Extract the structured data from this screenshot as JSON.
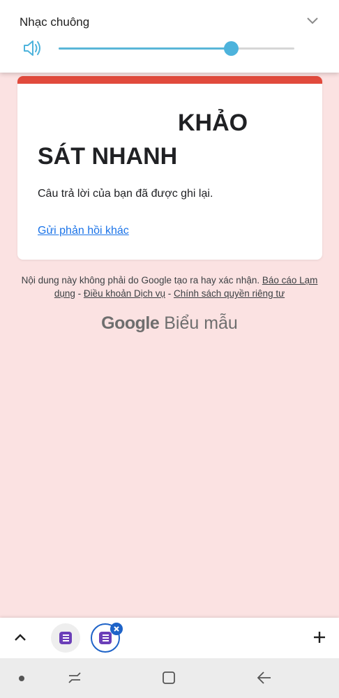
{
  "volume_panel": {
    "title": "Nhạc chuông",
    "level_percent": 73,
    "accent_color": "#4db3dc",
    "icons": {
      "speaker": "speaker-icon",
      "expand": "chevron-down-icon"
    }
  },
  "form": {
    "accent_color": "#e14a3c",
    "title_line1": "KHẢO",
    "title_line2": "SÁT NHANH",
    "confirmation": "Câu trả lời của bạn đã được ghi lại.",
    "resubmit_link": "Gửi phản hồi khác"
  },
  "disclaimer": {
    "text": "Nội dung này không phải do Google tạo ra hay xác nhận. ",
    "report_link": "Báo cáo Lạm dụng",
    "sep1": " - ",
    "terms_link": "Điều khoản Dịch vụ",
    "sep2": " - ",
    "privacy_link": "Chính sách quyền riêng tư"
  },
  "logo": {
    "brand": "Google",
    "product": "Biểu mẫu"
  },
  "bubble_bar": {
    "icons": [
      "chevron-up-icon",
      "forms-bubble-icon",
      "forms-bubble-icon",
      "close-icon",
      "plus-icon"
    ],
    "active_color": "#1e63c8"
  },
  "nav_bar": {
    "icons": [
      "dot-icon",
      "recent-apps-icon",
      "home-icon",
      "back-icon"
    ]
  }
}
